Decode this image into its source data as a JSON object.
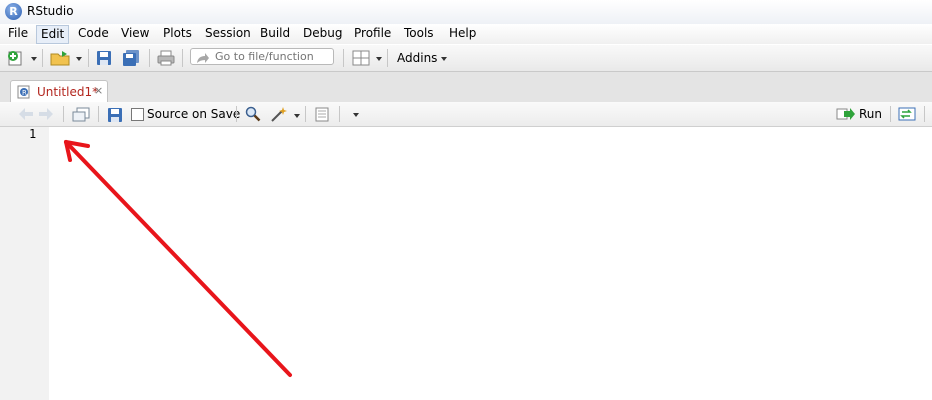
{
  "window": {
    "title": "RStudio"
  },
  "menu": {
    "items": [
      {
        "label": "File",
        "active": false
      },
      {
        "label": "Edit",
        "active": true
      },
      {
        "label": "Code",
        "active": false
      },
      {
        "label": "View",
        "active": false
      },
      {
        "label": "Plots",
        "active": false
      },
      {
        "label": "Session",
        "active": false
      },
      {
        "label": "Build",
        "active": false
      },
      {
        "label": "Debug",
        "active": false
      },
      {
        "label": "Profile",
        "active": false
      },
      {
        "label": "Tools",
        "active": false
      },
      {
        "label": "Help",
        "active": false
      }
    ]
  },
  "toolbar": {
    "goto_placeholder": "Go to file/function",
    "addins_label": "Addins"
  },
  "editor_tab": {
    "label": "Untitled1*",
    "close_glyph": "×"
  },
  "editor_toolbar": {
    "source_on_save_label": "Source on Save",
    "run_label": "Run"
  },
  "editor": {
    "line_numbers": [
      "1"
    ]
  },
  "colors": {
    "tab_label": "#b3261e",
    "annotation_arrow": "#e8151b"
  }
}
